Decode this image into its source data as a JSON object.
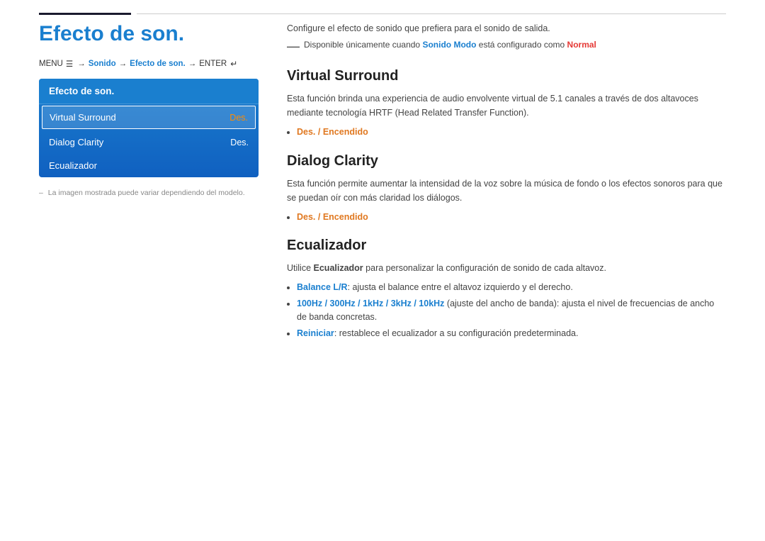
{
  "topbar": {
    "label": "top-bar"
  },
  "left": {
    "title": "Efecto de son.",
    "breadcrumb": {
      "menu": "MENU",
      "menu_icon": "☰",
      "arrow1": "→",
      "item1": "Sonido",
      "arrow2": "→",
      "item2": "Efecto de son.",
      "arrow3": "→",
      "enter": "ENTER",
      "enter_icon": "↵"
    },
    "menu_header": "Efecto de son.",
    "menu_items": [
      {
        "label": "Virtual Surround",
        "value": "Des.",
        "active": true,
        "value_color": "orange"
      },
      {
        "label": "Dialog Clarity",
        "value": "Des.",
        "active": false,
        "value_color": "normal"
      },
      {
        "label": "Ecualizador",
        "value": "",
        "active": false,
        "value_color": "normal"
      }
    ],
    "note": "La imagen mostrada puede variar dependiendo del modelo."
  },
  "right": {
    "intro": "Configure el efecto de sonido que prefiera para el sonido de salida.",
    "availability": {
      "pre": "Disponible únicamente cuando",
      "highlight_blue": "Sonido Modo",
      "mid": "está configurado como",
      "highlight_red": "Normal"
    },
    "sections": [
      {
        "id": "virtual-surround",
        "title": "Virtual Surround",
        "body": "Esta función brinda una experiencia de audio envolvente virtual de 5.1 canales a través de dos altavoces mediante tecnología HRTF (Head Related Transfer Function).",
        "bullets": [
          {
            "text": "Des. / Encendido",
            "type": "orange"
          }
        ]
      },
      {
        "id": "dialog-clarity",
        "title": "Dialog Clarity",
        "body": "Esta función permite aumentar la intensidad de la voz sobre la música de fondo o los efectos sonoros para que se puedan oír con más claridad los diálogos.",
        "bullets": [
          {
            "text": "Des. / Encendido",
            "type": "orange"
          }
        ]
      },
      {
        "id": "ecualizador",
        "title": "Ecualizador",
        "body_prefix": "Utilice",
        "body_highlight": "Ecualizador",
        "body_suffix": "para personalizar la configuración de sonido de cada altavoz.",
        "bullets": [
          {
            "prefix": "",
            "highlight": "Balance L/R",
            "suffix": ": ajusta el balance entre el altavoz izquierdo y el derecho.",
            "type": "blue"
          },
          {
            "prefix": "",
            "highlight": "100Hz / 300Hz / 1kHz / 3kHz / 10kHz",
            "suffix": " (ajuste del ancho de banda): ajusta el nivel de frecuencias de ancho de banda concretas.",
            "type": "blue"
          },
          {
            "prefix": "",
            "highlight": "Reiniciar",
            "suffix": ": restablece el ecualizador a su configuración predeterminada.",
            "type": "blue"
          }
        ]
      }
    ]
  }
}
